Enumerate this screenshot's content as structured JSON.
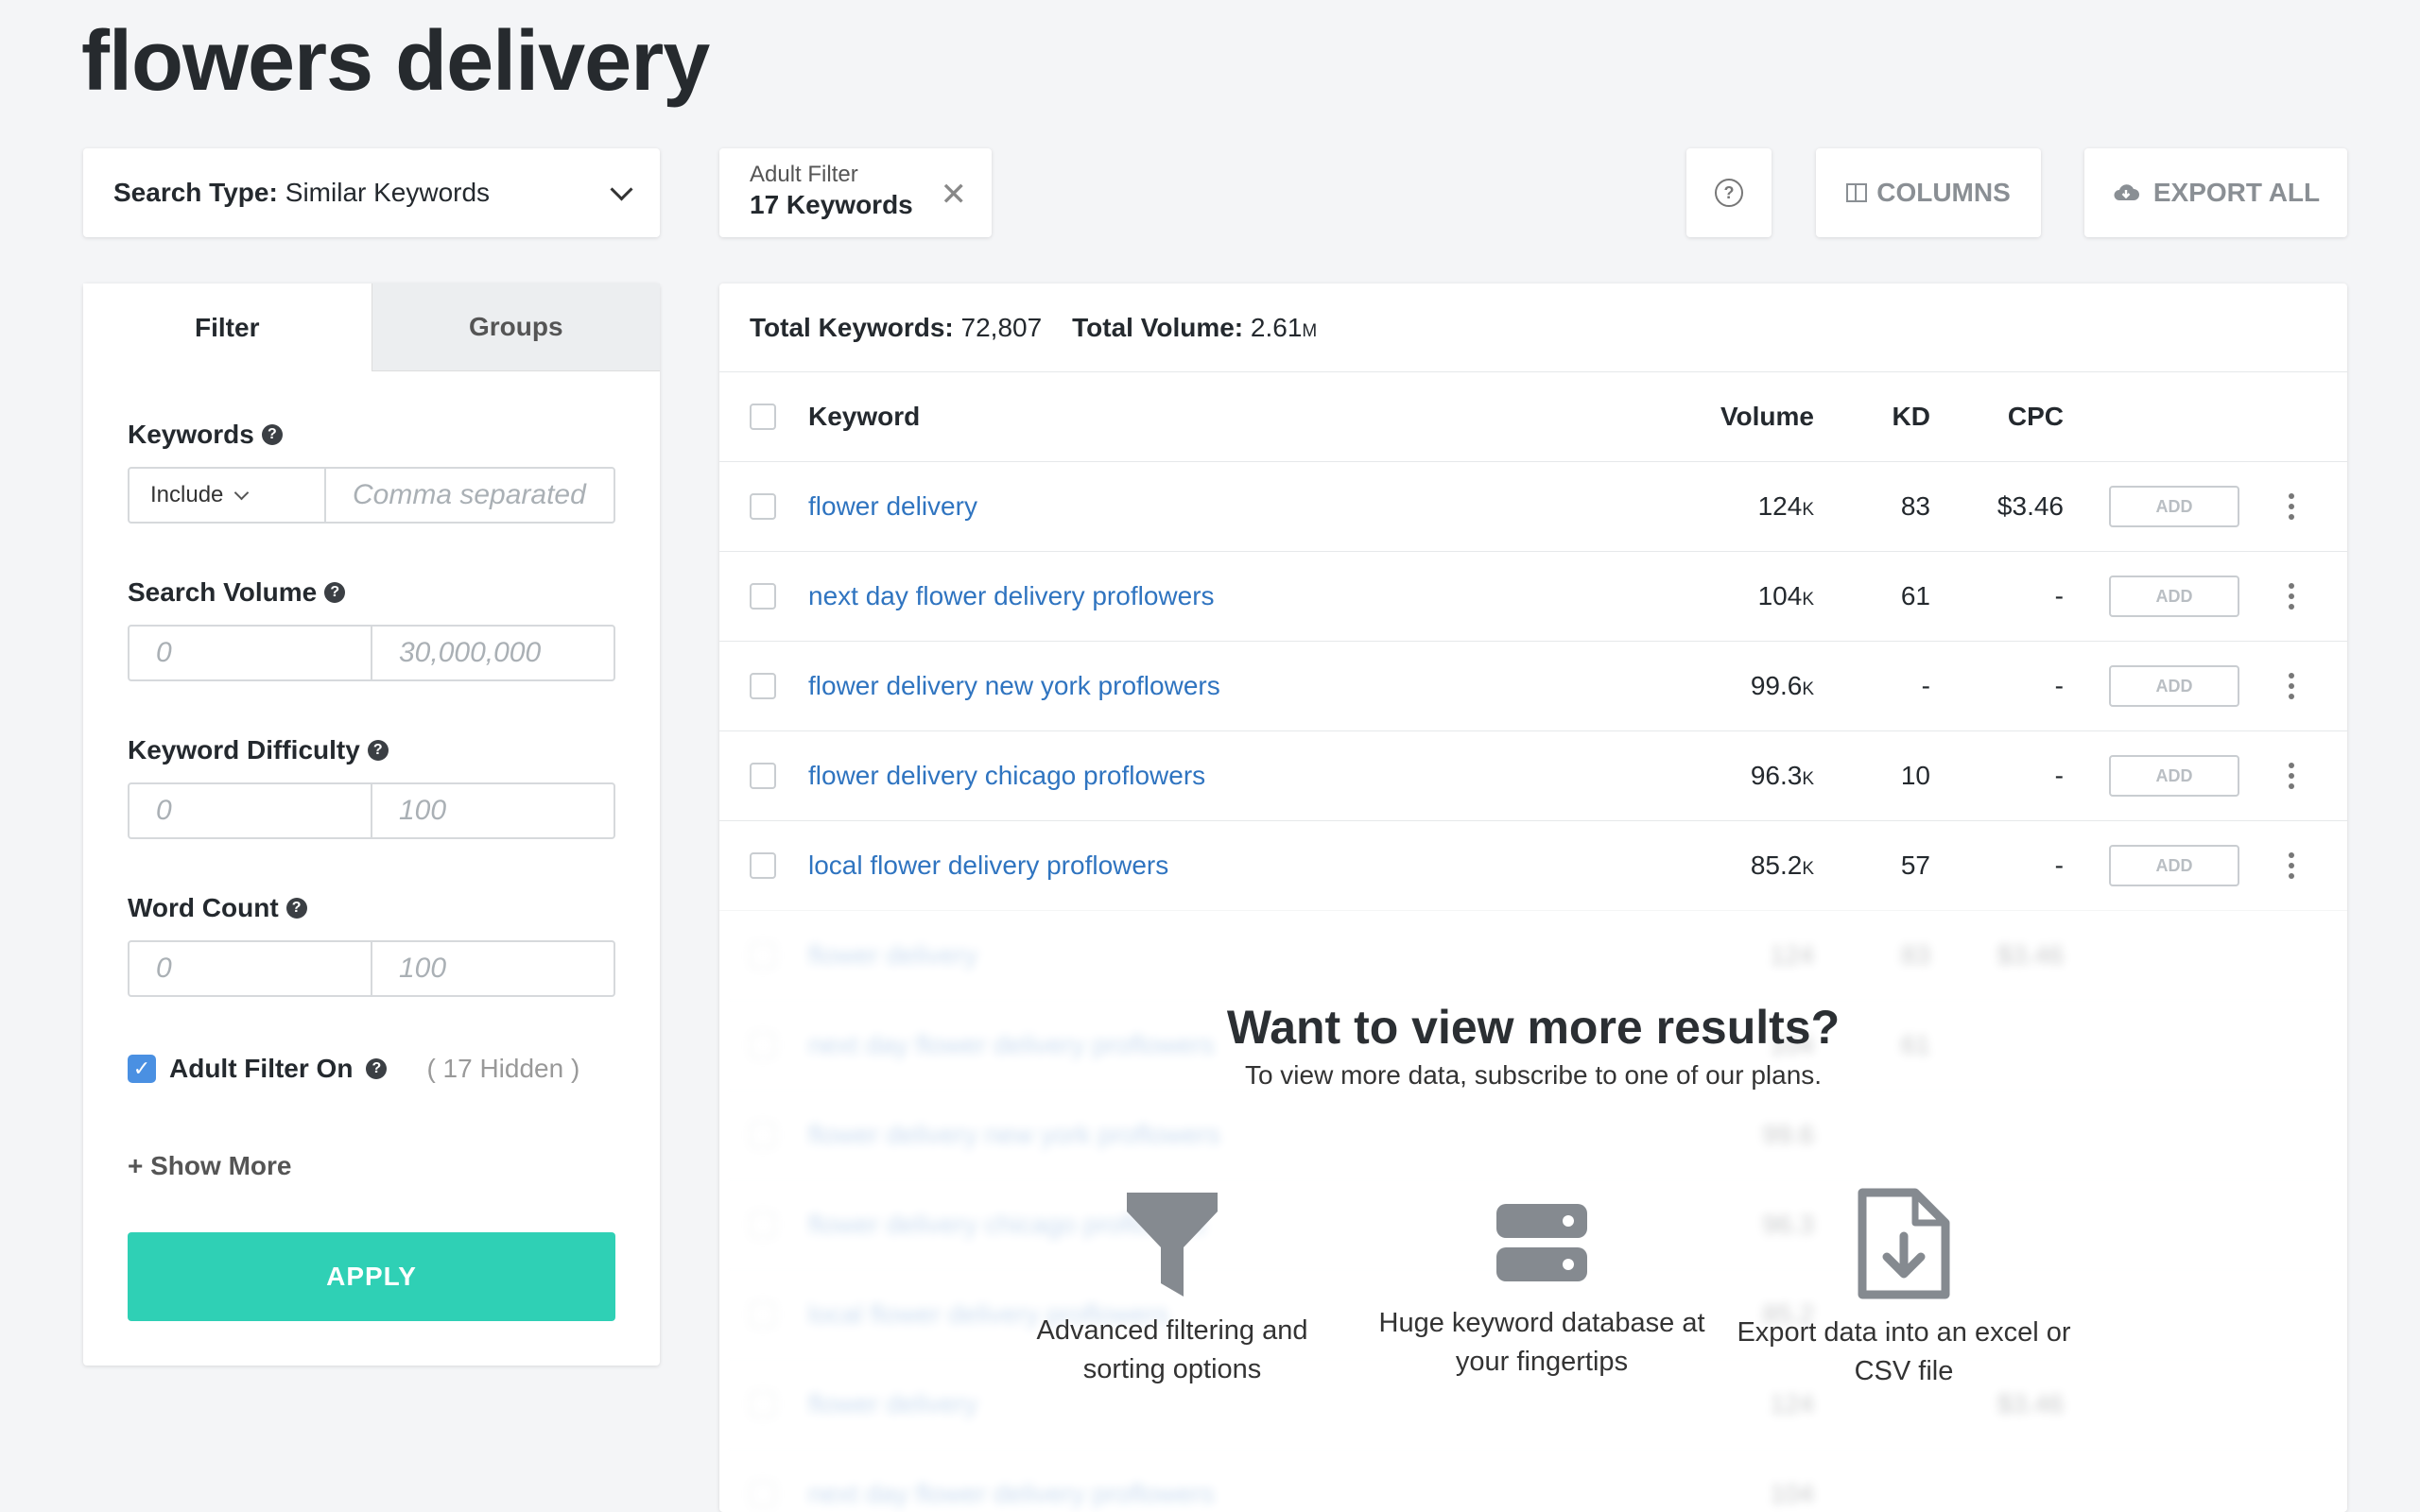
{
  "page": {
    "title": "flowers delivery"
  },
  "toolbar": {
    "search_type_label": "Search Type:",
    "search_type_value": "Similar Keywords",
    "adult_filter_label": "Adult Filter",
    "adult_filter_value": "17 Keywords",
    "columns_label": "COLUMNS",
    "export_label": "EXPORT ALL"
  },
  "filters": {
    "tabs": [
      "Filter",
      "Groups"
    ],
    "keywords": {
      "label": "Keywords",
      "mode": "Include",
      "placeholder": "Comma separated"
    },
    "search_volume": {
      "label": "Search Volume",
      "min_placeholder": "0",
      "max_placeholder": "30,000,000"
    },
    "keyword_difficulty": {
      "label": "Keyword Difficulty",
      "min_placeholder": "0",
      "max_placeholder": "100"
    },
    "word_count": {
      "label": "Word Count",
      "min_placeholder": "0",
      "max_placeholder": "100"
    },
    "adult_filter": {
      "label": "Adult Filter On",
      "checked": true,
      "hidden": "( 17 Hidden )"
    },
    "show_more": "+ Show More",
    "apply": "APPLY"
  },
  "results": {
    "total_keywords_label": "Total Keywords:",
    "total_keywords": "72,807",
    "total_volume_label": "Total Volume:",
    "total_volume": "2.61",
    "total_volume_unit": "M",
    "columns": {
      "keyword": "Keyword",
      "volume": "Volume",
      "kd": "KD",
      "cpc": "CPC"
    },
    "add_label": "ADD",
    "rows": [
      {
        "keyword": "flower delivery",
        "volume": "124",
        "unit": "K",
        "kd": "83",
        "cpc": "$3.46"
      },
      {
        "keyword": "next day flower delivery proflowers",
        "volume": "104",
        "unit": "K",
        "kd": "61",
        "cpc": "-"
      },
      {
        "keyword": "flower delivery new york proflowers",
        "volume": "99.6",
        "unit": "K",
        "kd": "-",
        "cpc": "-"
      },
      {
        "keyword": "flower delivery chicago proflowers",
        "volume": "96.3",
        "unit": "K",
        "kd": "10",
        "cpc": "-"
      },
      {
        "keyword": "local flower delivery proflowers",
        "volume": "85.2",
        "unit": "K",
        "kd": "57",
        "cpc": "-"
      }
    ]
  },
  "upsell": {
    "title": "Want to view more results?",
    "subtitle": "To view more data, subscribe to one of our plans.",
    "features": [
      {
        "icon": "funnel-icon",
        "text": "Advanced filtering and sorting options"
      },
      {
        "icon": "database-icon",
        "text": "Huge keyword database at your fingertips"
      },
      {
        "icon": "file-download-icon",
        "text": "Export data into an excel or CSV file"
      }
    ]
  },
  "colors": {
    "accent": "#2fd0b5",
    "link": "#2f74c0",
    "checkbox": "#4a90e2"
  }
}
